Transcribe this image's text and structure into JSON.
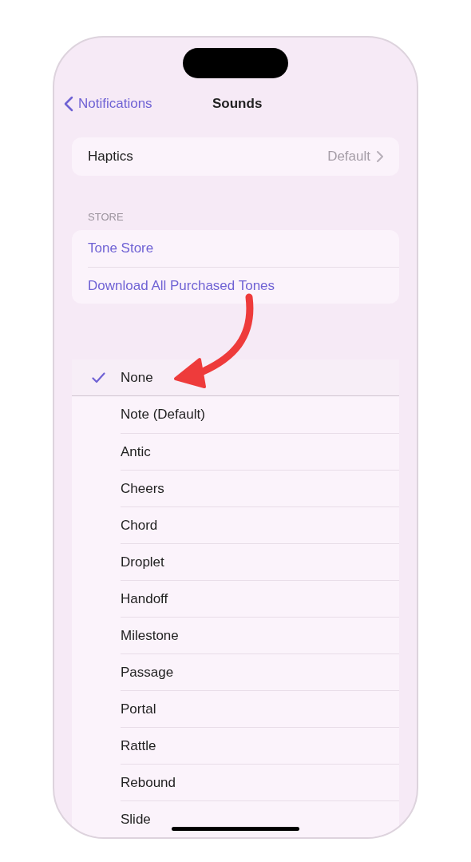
{
  "nav": {
    "back": "Notifications",
    "title": "Sounds"
  },
  "haptics": {
    "label": "Haptics",
    "value": "Default"
  },
  "store": {
    "header": "STORE",
    "items": [
      "Tone Store",
      "Download All Purchased Tones"
    ]
  },
  "tones": [
    {
      "name": "None",
      "selected": true
    },
    {
      "name": "Note (Default)",
      "selected": false
    },
    {
      "name": "Antic",
      "selected": false
    },
    {
      "name": "Cheers",
      "selected": false
    },
    {
      "name": "Chord",
      "selected": false
    },
    {
      "name": "Droplet",
      "selected": false
    },
    {
      "name": "Handoff",
      "selected": false
    },
    {
      "name": "Milestone",
      "selected": false
    },
    {
      "name": "Passage",
      "selected": false
    },
    {
      "name": "Portal",
      "selected": false
    },
    {
      "name": "Rattle",
      "selected": false
    },
    {
      "name": "Rebound",
      "selected": false
    },
    {
      "name": "Slide",
      "selected": false
    }
  ]
}
